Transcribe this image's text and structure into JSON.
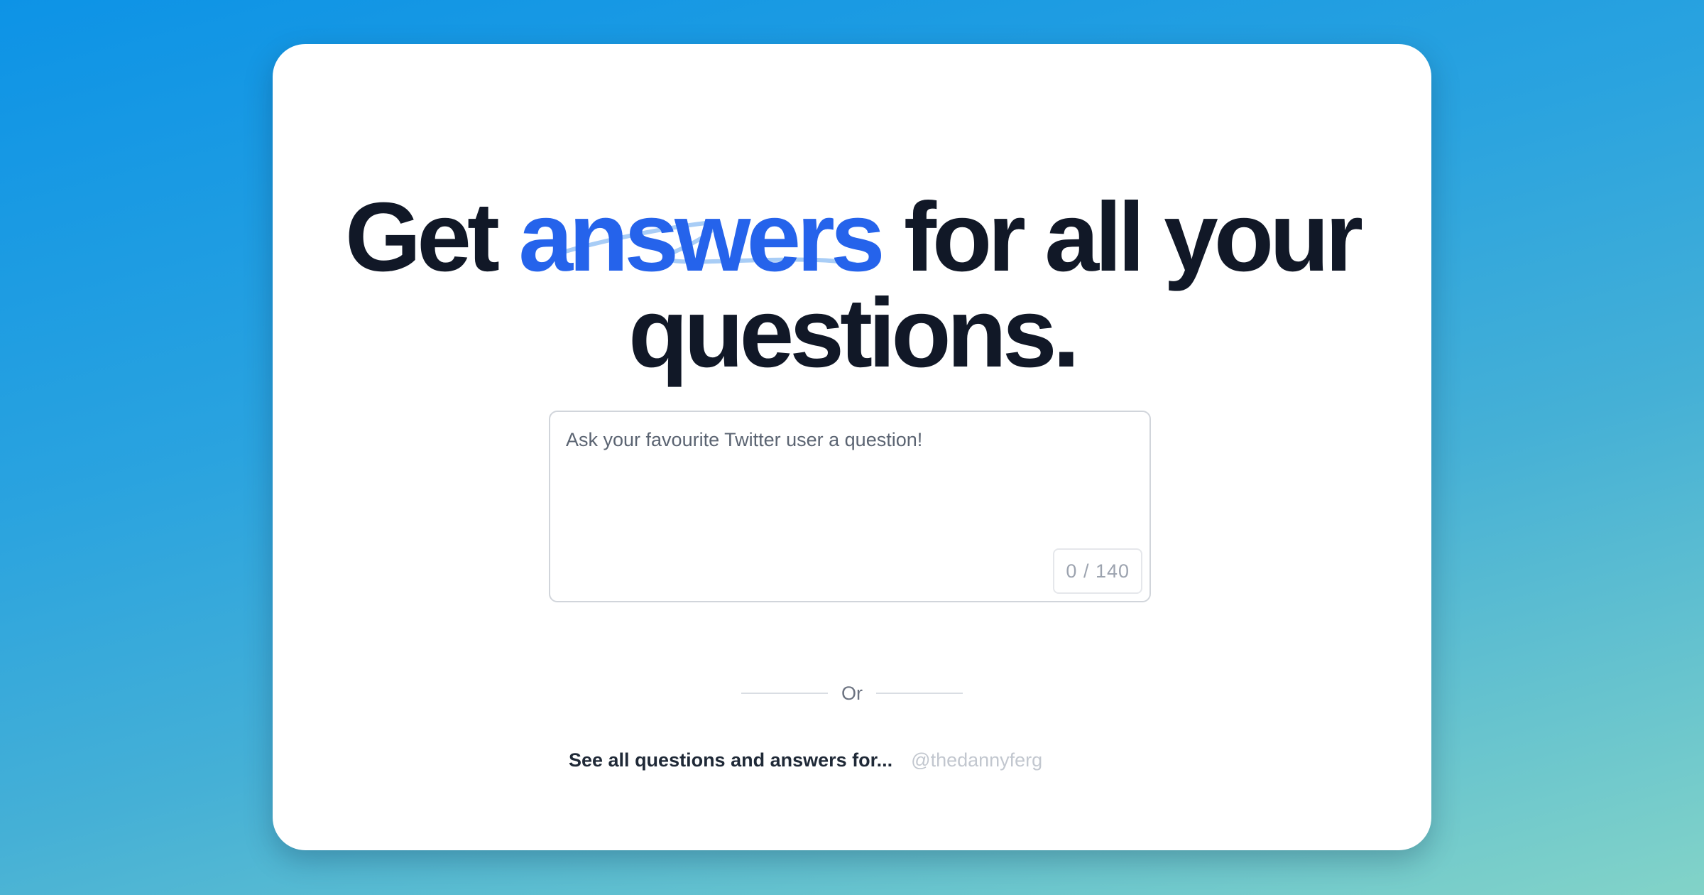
{
  "headline": {
    "part1": "Get ",
    "accent": "answers",
    "part2": " for all your",
    "line2": "questions."
  },
  "question": {
    "placeholder": "Ask your favourite Twitter user a question!",
    "value": "",
    "counter": "0 / 140"
  },
  "divider": {
    "label": "Or"
  },
  "see_all": {
    "label": "See all questions and answers for...",
    "username_placeholder": "@thedannyferg"
  },
  "colors": {
    "accent": "#2563eb",
    "headline": "#111827",
    "squiggle": "#a8cdf6",
    "background_start": "#0d93e6",
    "background_end": "#82d3c8"
  }
}
